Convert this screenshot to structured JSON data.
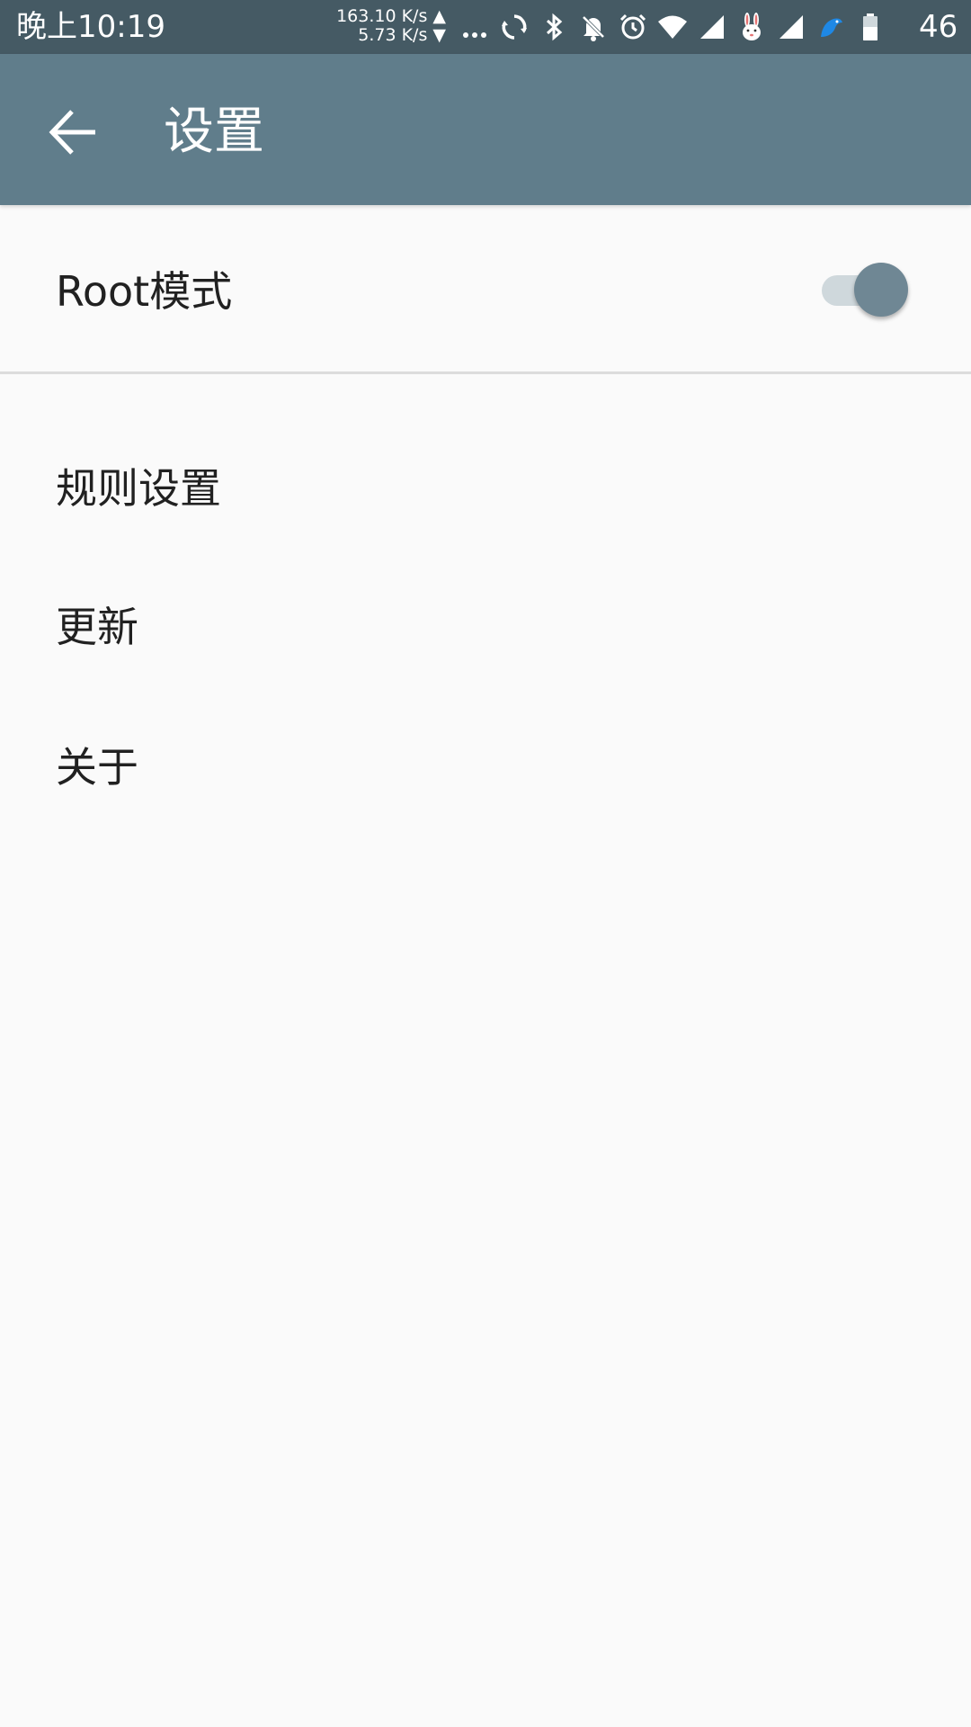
{
  "status_bar": {
    "time": "晚上10:19",
    "upload_speed": "163.10 K/s ▲",
    "download_speed": "5.73 K/s ▼",
    "battery_level": "46",
    "icons": [
      "more-dots-icon",
      "sync-icon",
      "bluetooth-icon",
      "bell-off-icon",
      "alarm-icon",
      "wifi-icon",
      "signal-icon",
      "rabbit-icon",
      "signal-2-icon",
      "bird-icon",
      "battery-icon"
    ]
  },
  "app_bar": {
    "title": "设置",
    "back_icon": "arrow-left-icon",
    "background": "#607d8b"
  },
  "settings": {
    "root_mode": {
      "label": "Root模式",
      "enabled": true
    },
    "items": [
      {
        "label": "规则设置"
      },
      {
        "label": "更新"
      },
      {
        "label": "关于"
      }
    ]
  },
  "colors": {
    "status_bar": "#455a64",
    "app_bar": "#607d8b",
    "switch_thumb": "#6f8794",
    "switch_track": "#cfd8dc",
    "background": "#fafafa"
  }
}
